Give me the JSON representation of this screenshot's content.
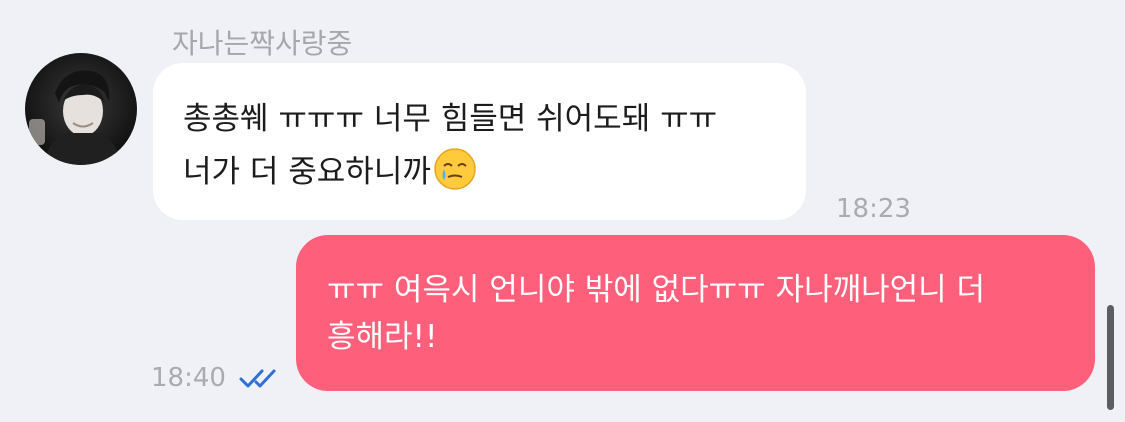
{
  "chat": {
    "sender_name": "자나는짝사랑중",
    "incoming": {
      "text": "총총쒜 ㅠㅠㅠ 너무 힘들면 쉬어도돼 ㅠㅠ 너가 더 중요하니까",
      "emoji": "face-holding-back-tears",
      "time": "18:23"
    },
    "outgoing": {
      "text": "ㅠㅠ 여윽시 언니야 밖에 없다ㅠㅠ 자나깨나언니 더 흥해라!!",
      "time": "18:40",
      "status_icon": "double-check-read-icon"
    }
  },
  "colors": {
    "background": "#eff1f6",
    "incoming_bubble": "#ffffff",
    "outgoing_bubble": "#fe5f7b",
    "read_check": "#2f6fd6",
    "meta_text": "#a9abb1"
  }
}
